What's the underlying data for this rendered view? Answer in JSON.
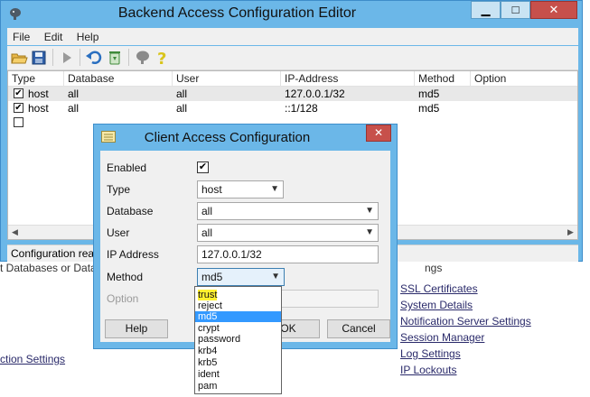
{
  "window": {
    "title": "Backend Access Configuration Editor"
  },
  "menu": [
    "File",
    "Edit",
    "Help"
  ],
  "toolbar_icons": [
    "open-folder-icon",
    "save-icon",
    "play-icon",
    "undo-icon",
    "recycle-icon",
    "elephant-icon",
    "help-icon"
  ],
  "list": {
    "columns": [
      "Type",
      "Database",
      "User",
      "IP-Address",
      "Method",
      "Option"
    ],
    "rows": [
      {
        "checked": true,
        "type": "host",
        "database": "all",
        "user": "all",
        "ip": "127.0.0.1/32",
        "method": "md5",
        "selected": true
      },
      {
        "checked": true,
        "type": "host",
        "database": "all",
        "user": "all",
        "ip": "::1/128",
        "method": "md5",
        "selected": false
      },
      {
        "checked": false,
        "type": "",
        "database": "",
        "user": "",
        "ip": "",
        "method": "",
        "selected": false
      }
    ]
  },
  "status": "Configuration read",
  "dialog": {
    "title": "Client Access Configuration",
    "enabled_label": "Enabled",
    "enabled_checked": true,
    "type_label": "Type",
    "type_value": "host",
    "database_label": "Database",
    "database_value": "all",
    "user_label": "User",
    "user_value": "all",
    "ip_label": "IP Address",
    "ip_value": "127.0.0.1/32",
    "method_label": "Method",
    "method_value": "md5",
    "option_label": "Option",
    "help_button": "Help",
    "ok_button": "OK",
    "cancel_button": "Cancel"
  },
  "method_options": [
    "trust",
    "reject",
    "md5",
    "crypt",
    "password",
    "krb4",
    "krb5",
    "ident",
    "pam"
  ],
  "method_selected": "md5",
  "method_highlighted": "trust",
  "background": {
    "left_link": "ction Settings",
    "left_partial": "t Databases or Datase",
    "right_partial": "ngs",
    "links": [
      "SSL Certificates",
      "System Details",
      "Notification Server Settings",
      "Session Manager",
      "Log Settings",
      "IP Lockouts"
    ]
  },
  "colors": {
    "titlebar": "#6bb7e8",
    "close": "#c7504b",
    "selection": "#3399ff",
    "highlight": "#fff12f"
  }
}
